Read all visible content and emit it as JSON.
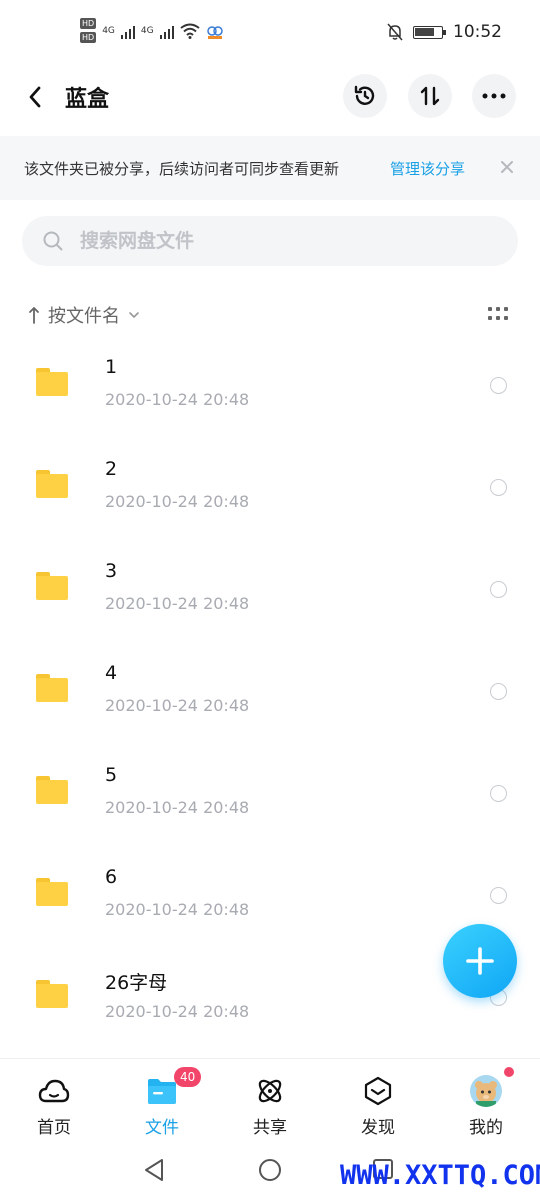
{
  "status_bar": {
    "hd1": "HD",
    "hd2": "HD",
    "net1": "4G",
    "net2": "4G",
    "time": "10:52",
    "battery_level": 0.75
  },
  "header": {
    "title": "蓝盒"
  },
  "banner": {
    "text": "该文件夹已被分享，后续访问者可同步查看更新",
    "link": "管理该分享"
  },
  "search": {
    "placeholder": "搜索网盘文件"
  },
  "sort": {
    "label": "按文件名"
  },
  "files": [
    {
      "name": "1",
      "date": "2020-10-24  20:48"
    },
    {
      "name": "2",
      "date": "2020-10-24  20:48"
    },
    {
      "name": "3",
      "date": "2020-10-24  20:48"
    },
    {
      "name": "4",
      "date": "2020-10-24  20:48"
    },
    {
      "name": "5",
      "date": "2020-10-24  20:48"
    },
    {
      "name": "6",
      "date": "2020-10-24  20:48"
    },
    {
      "name": "26字母",
      "date": "2020-10-24  20:48"
    }
  ],
  "nav": {
    "items": [
      {
        "label": "首页",
        "icon": "home-cloud-icon"
      },
      {
        "label": "文件",
        "icon": "folder-icon"
      },
      {
        "label": "共享",
        "icon": "atom-icon"
      },
      {
        "label": "发现",
        "icon": "cube-icon"
      },
      {
        "label": "我的",
        "icon": "avatar"
      }
    ],
    "share_badge": "40"
  },
  "colors": {
    "accent": "#1aa1e6",
    "folder": "#fdd143",
    "badge": "#f2456a"
  },
  "watermark": "WWW.XXTTQ.COM"
}
